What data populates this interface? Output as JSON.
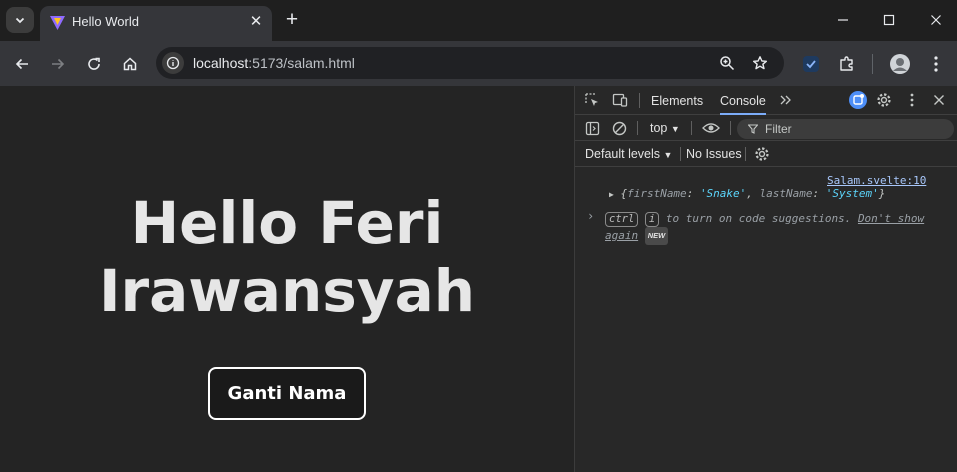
{
  "browser": {
    "tab_title": "Hello World",
    "tab_close": "✕",
    "new_tab": "+",
    "url_host": "localhost",
    "url_path": ":5173/salam.html"
  },
  "page": {
    "heading_line1": "Hello Feri",
    "heading_line2": "Irawansyah",
    "button_label": "Ganti Nama"
  },
  "devtools": {
    "tabs": [
      "Elements",
      "Console"
    ],
    "active_tab": "Console",
    "context": "top",
    "filter_placeholder": "Filter",
    "levels": "Default levels",
    "issues": "No Issues",
    "log_source": "Salam.svelte:10",
    "log_object": {
      "key1": "firstName",
      "val1": "'Snake'",
      "key2": "lastName",
      "val2": "'System'"
    },
    "hint_kbd1": "ctrl",
    "hint_kbd2": "i",
    "hint_text": "to turn on code suggestions.",
    "hint_link_line1": "Don't show",
    "hint_link_line2": "again",
    "new_badge": "NEW"
  },
  "colors": {
    "accent": "#7cacf8",
    "string_value": "#5cd5fb",
    "page_bg": "#242424",
    "devtools_bg": "#282828"
  }
}
